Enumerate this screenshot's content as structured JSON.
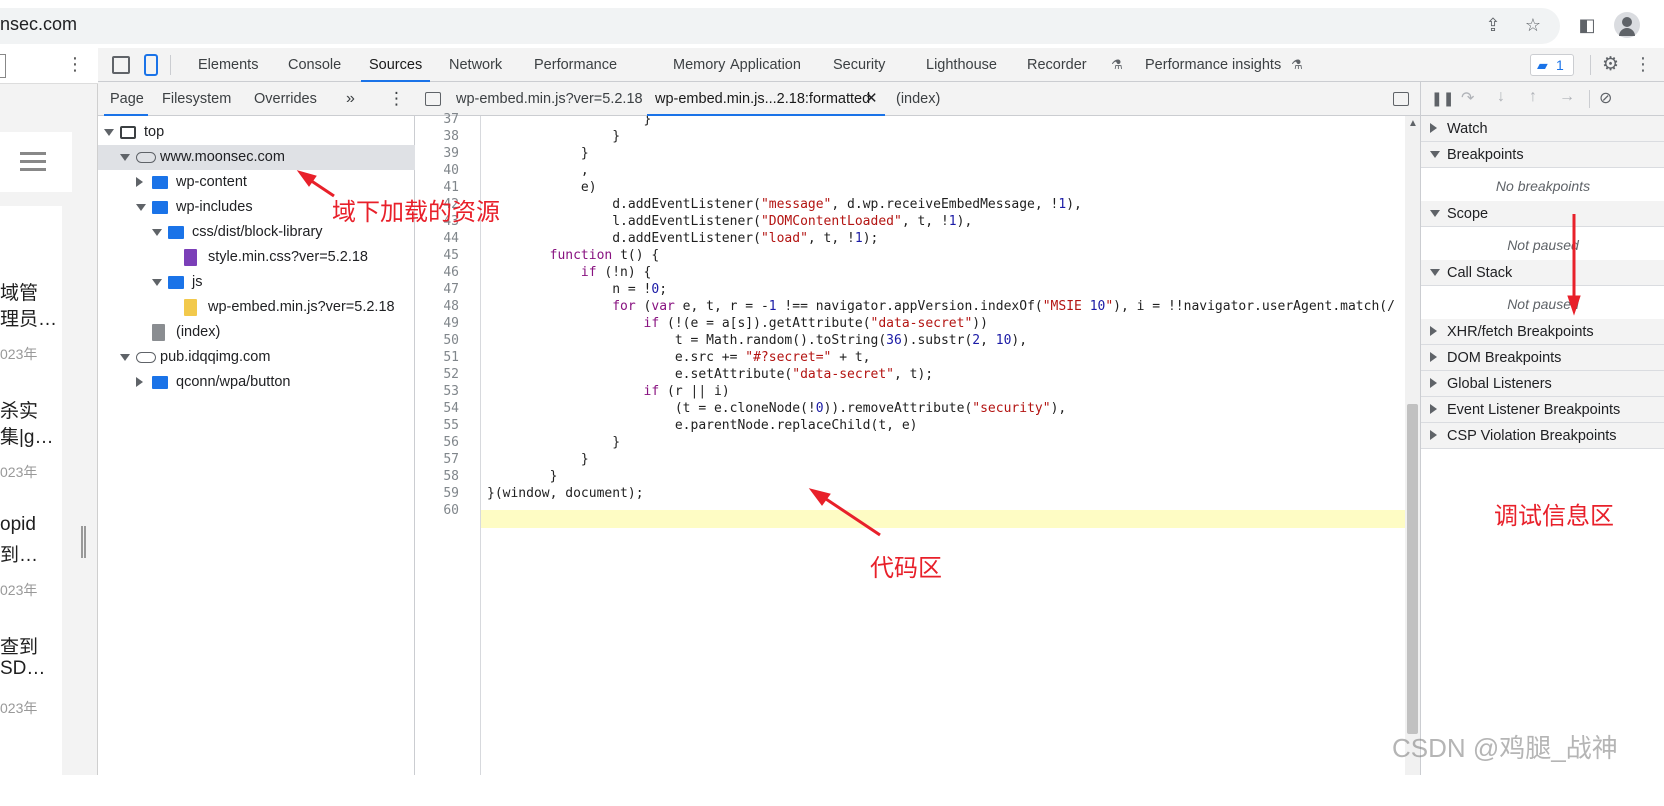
{
  "browser": {
    "address": "nsec.com"
  },
  "webpage": {
    "snippets": [
      "域管",
      "理员…",
      "023年",
      "杀实",
      "集|g…",
      "023年",
      "opid",
      "到…",
      "023年",
      "查到",
      "SD…",
      "023年"
    ]
  },
  "devtools": {
    "tabs": [
      "Elements",
      "Console",
      "Sources",
      "Network",
      "Performance",
      "Memory",
      "Application",
      "Security",
      "Lighthouse",
      "Recorder",
      "Performance insights"
    ],
    "issues_badge": "1",
    "navigator_tabs": [
      "Page",
      "Filesystem",
      "Overrides"
    ],
    "tree": [
      {
        "label": "top",
        "depth": 0,
        "kind": "frame",
        "expanded": true
      },
      {
        "label": "www.moonsec.com",
        "depth": 1,
        "kind": "cloud",
        "expanded": true,
        "selected": true
      },
      {
        "label": "wp-content",
        "depth": 2,
        "kind": "folder",
        "expanded": false
      },
      {
        "label": "wp-includes",
        "depth": 2,
        "kind": "folder",
        "expanded": true
      },
      {
        "label": "css/dist/block-library",
        "depth": 3,
        "kind": "folder",
        "expanded": true
      },
      {
        "label": "style.min.css?ver=5.2.18",
        "depth": 4,
        "kind": "css"
      },
      {
        "label": "js",
        "depth": 3,
        "kind": "folder",
        "expanded": true
      },
      {
        "label": "wp-embed.min.js?ver=5.2.18",
        "depth": 4,
        "kind": "js"
      },
      {
        "label": "(index)",
        "depth": 2,
        "kind": "doc"
      },
      {
        "label": "pub.idqqimg.com",
        "depth": 1,
        "kind": "cloud",
        "expanded": true
      },
      {
        "label": "qconn/wpa/button",
        "depth": 2,
        "kind": "folder",
        "expanded": false
      }
    ],
    "editor_tabs": [
      "wp-embed.min.js?ver=5.2.18",
      "wp-embed.min.js...2.18:formatted",
      "(index)"
    ],
    "code_lines": [
      {
        "n": "37",
        "t": "                    }"
      },
      {
        "n": "38",
        "t": "                }"
      },
      {
        "n": "39",
        "t": "            }"
      },
      {
        "n": "40",
        "t": "            ,"
      },
      {
        "n": "41",
        "t": "            e)"
      },
      {
        "n": "42",
        "t": "                d.addEventListener(\"message\", d.wp.receiveEmbedMessage, !1),"
      },
      {
        "n": "43",
        "t": "                l.addEventListener(\"DOMContentLoaded\", t, !1),"
      },
      {
        "n": "44",
        "t": "                d.addEventListener(\"load\", t, !1);"
      },
      {
        "n": "45",
        "t": "        function t() {"
      },
      {
        "n": "46",
        "t": "            if (!n) {"
      },
      {
        "n": "47",
        "t": "                n = !0;"
      },
      {
        "n": "48",
        "t": "                for (var e, t, r = -1 !== navigator.appVersion.indexOf(\"MSIE 10\"), i = !!navigator.userAgent.match(/"
      },
      {
        "n": "49",
        "t": "                    if (!(e = a[s]).getAttribute(\"data-secret\"))"
      },
      {
        "n": "50",
        "t": "                        t = Math.random().toString(36).substr(2, 10),"
      },
      {
        "n": "51",
        "t": "                        e.src += \"#?secret=\" + t,"
      },
      {
        "n": "52",
        "t": "                        e.setAttribute(\"data-secret\", t);"
      },
      {
        "n": "53",
        "t": "                    if (r || i)"
      },
      {
        "n": "54",
        "t": "                        (t = e.cloneNode(!0)).removeAttribute(\"security\"),"
      },
      {
        "n": "55",
        "t": "                        e.parentNode.replaceChild(t, e)"
      },
      {
        "n": "56",
        "t": "                }"
      },
      {
        "n": "57",
        "t": "            }"
      },
      {
        "n": "58",
        "t": "        }"
      },
      {
        "n": "59",
        "t": "}(window, document);"
      },
      {
        "n": "60",
        "t": ""
      }
    ],
    "debugger": {
      "sections": [
        "Watch",
        "Breakpoints",
        "Scope",
        "Call Stack",
        "XHR/fetch Breakpoints",
        "DOM Breakpoints",
        "Global Listeners",
        "Event Listener Breakpoints",
        "CSP Violation Breakpoints"
      ],
      "no_breakpoints": "No breakpoints",
      "not_paused": "Not paused"
    }
  },
  "annotations": {
    "resources": "域下加载的资源",
    "code_area": "代码区",
    "debug_area": "调试信息区",
    "watermark": "CSDN @鸡腿_战神"
  },
  "colors": {
    "accent": "#1a73e8",
    "annotation": "#e8202a",
    "highlight": "#fefcc4"
  }
}
